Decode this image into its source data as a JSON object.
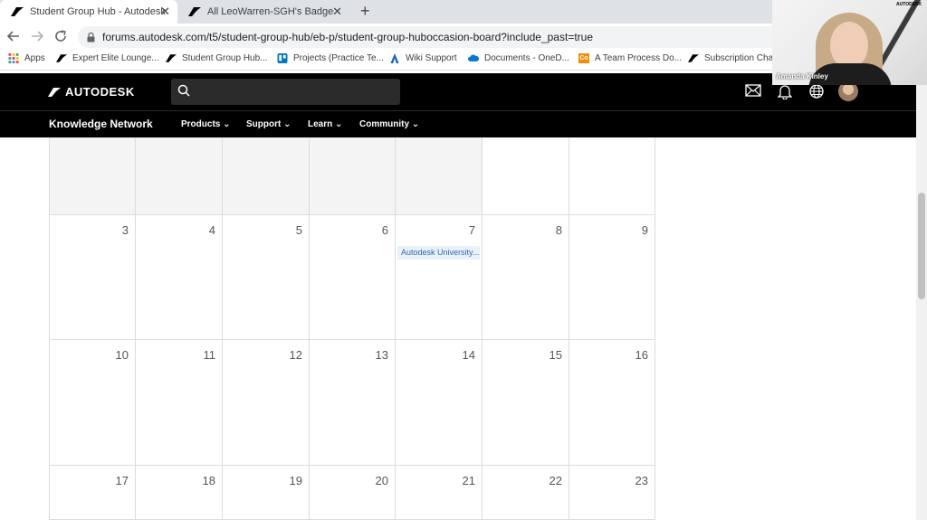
{
  "browser": {
    "tabs": [
      {
        "title": "Student Group Hub - Autodesk C",
        "active": true
      },
      {
        "title": "All LeoWarren-SGH's Badges - Au",
        "active": false
      }
    ],
    "tab_close": "✕",
    "new_tab": "+",
    "url": "forums.autodesk.com/t5/student-group-hub/eb-p/student-group-huboccasion-board?include_past=true",
    "bookmarks": [
      {
        "label": "Apps",
        "icon": "apps-grid-icon"
      },
      {
        "label": "Expert Elite Lounge...",
        "icon": "autodesk-icon"
      },
      {
        "label": "Student Group Hub...",
        "icon": "autodesk-icon"
      },
      {
        "label": "Projects (Practice Te...",
        "icon": "trello-icon"
      },
      {
        "label": "Wiki Support",
        "icon": "a-icon"
      },
      {
        "label": "Documents - OneD...",
        "icon": "onedrive-icon"
      },
      {
        "label": "A Team Process Do...",
        "icon": "co-icon"
      },
      {
        "label": "Subscription Char",
        "icon": "autodesk-icon"
      }
    ],
    "co_icon_text": "Co"
  },
  "header": {
    "logo_text": "AUTODESK",
    "search_placeholder": "",
    "section_title": "Knowledge Network",
    "nav": [
      {
        "label": "Products"
      },
      {
        "label": "Support"
      },
      {
        "label": "Learn"
      },
      {
        "label": "Community"
      }
    ],
    "chevron": "⌄"
  },
  "calendar": {
    "past_row": [
      "",
      "",
      "",
      "",
      "",
      "",
      ""
    ],
    "weeks": [
      {
        "days": [
          "3",
          "4",
          "5",
          "6",
          "7",
          "8",
          "9"
        ]
      },
      {
        "days": [
          "10",
          "11",
          "12",
          "13",
          "14",
          "15",
          "16"
        ]
      },
      {
        "days": [
          "17",
          "18",
          "19",
          "20",
          "21",
          "22",
          "23"
        ]
      }
    ],
    "events": [
      {
        "week": 0,
        "day": 4,
        "title": "Autodesk University..."
      }
    ]
  },
  "webcam": {
    "name": "Amanda Kinley",
    "logo": "AUTODESK"
  },
  "colors": {
    "header_bg": "#000000",
    "event_bg": "#e9f1fb",
    "event_text": "#2f68b0"
  }
}
